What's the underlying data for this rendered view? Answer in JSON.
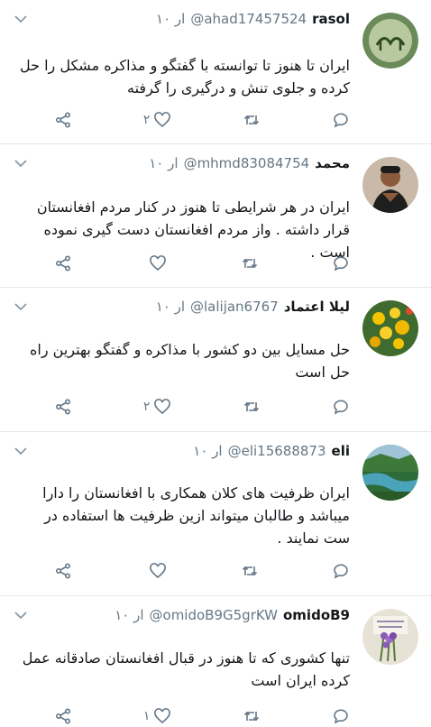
{
  "tweets": [
    {
      "name": "rasol",
      "handle": "@ahad17457524",
      "time": "۱۰ ار",
      "text": "ایران تا هنوز تا توانسته با گفتگو و مذاکره مشکل را حل کرده و جلوی تنش و درگیری را گرفته",
      "like_count": "۲",
      "avatar": "calligraphy-avatar"
    },
    {
      "name": "محمد",
      "handle": "@mhmd83084754",
      "time": "۱۰ ار",
      "text": "ایران در هر شرایطی تا هنوز در کنار مردم افغانستان قرار داشته . واز مردم افغانستان دست گیری نموده است .",
      "like_count": "",
      "avatar": "man-avatar"
    },
    {
      "name": "لیلا اعتماد",
      "handle": "@lalijan6767",
      "time": "۱۰ ار",
      "text": "حل مسایل بین دو کشور با مذاکره و گفتگو بهترین راه حل است",
      "like_count": "۲",
      "avatar": "flowers-avatar"
    },
    {
      "name": "eli",
      "handle": "@eli15688873",
      "time": "۱۰ ار",
      "text": "ایران ظرفیت های کلان همکاری با افغانستان را دارا میباشد و طالبان میتواند ازین ظرفیت ها استفاده در ست نمایند .",
      "like_count": "",
      "avatar": "river-avatar"
    },
    {
      "name": "omidoB9",
      "handle": "@omidoB9G5grKW",
      "time": "۱۰ ار",
      "text": "تنها کشوری که تا هنوز در قبال افغانستان صادقانه عمل کرده ایران است",
      "like_count": "۱",
      "avatar": "lavender-avatar"
    }
  ],
  "colors": {
    "icon_gray": "#657786",
    "divider": "#e1e8ed",
    "text": "#14171a"
  }
}
